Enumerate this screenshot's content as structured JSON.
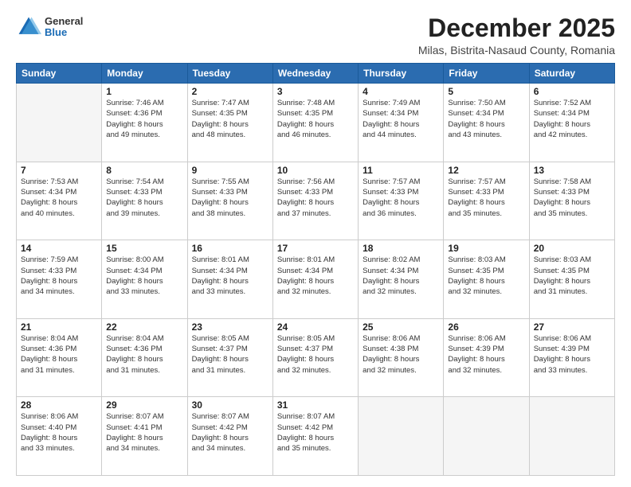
{
  "logo": {
    "general": "General",
    "blue": "Blue"
  },
  "title": "December 2025",
  "location": "Milas, Bistrita-Nasaud County, Romania",
  "days_header": [
    "Sunday",
    "Monday",
    "Tuesday",
    "Wednesday",
    "Thursday",
    "Friday",
    "Saturday"
  ],
  "weeks": [
    [
      {
        "day": "",
        "info": ""
      },
      {
        "day": "1",
        "info": "Sunrise: 7:46 AM\nSunset: 4:36 PM\nDaylight: 8 hours\nand 49 minutes."
      },
      {
        "day": "2",
        "info": "Sunrise: 7:47 AM\nSunset: 4:35 PM\nDaylight: 8 hours\nand 48 minutes."
      },
      {
        "day": "3",
        "info": "Sunrise: 7:48 AM\nSunset: 4:35 PM\nDaylight: 8 hours\nand 46 minutes."
      },
      {
        "day": "4",
        "info": "Sunrise: 7:49 AM\nSunset: 4:34 PM\nDaylight: 8 hours\nand 44 minutes."
      },
      {
        "day": "5",
        "info": "Sunrise: 7:50 AM\nSunset: 4:34 PM\nDaylight: 8 hours\nand 43 minutes."
      },
      {
        "day": "6",
        "info": "Sunrise: 7:52 AM\nSunset: 4:34 PM\nDaylight: 8 hours\nand 42 minutes."
      }
    ],
    [
      {
        "day": "7",
        "info": "Sunrise: 7:53 AM\nSunset: 4:34 PM\nDaylight: 8 hours\nand 40 minutes."
      },
      {
        "day": "8",
        "info": "Sunrise: 7:54 AM\nSunset: 4:33 PM\nDaylight: 8 hours\nand 39 minutes."
      },
      {
        "day": "9",
        "info": "Sunrise: 7:55 AM\nSunset: 4:33 PM\nDaylight: 8 hours\nand 38 minutes."
      },
      {
        "day": "10",
        "info": "Sunrise: 7:56 AM\nSunset: 4:33 PM\nDaylight: 8 hours\nand 37 minutes."
      },
      {
        "day": "11",
        "info": "Sunrise: 7:57 AM\nSunset: 4:33 PM\nDaylight: 8 hours\nand 36 minutes."
      },
      {
        "day": "12",
        "info": "Sunrise: 7:57 AM\nSunset: 4:33 PM\nDaylight: 8 hours\nand 35 minutes."
      },
      {
        "day": "13",
        "info": "Sunrise: 7:58 AM\nSunset: 4:33 PM\nDaylight: 8 hours\nand 35 minutes."
      }
    ],
    [
      {
        "day": "14",
        "info": "Sunrise: 7:59 AM\nSunset: 4:33 PM\nDaylight: 8 hours\nand 34 minutes."
      },
      {
        "day": "15",
        "info": "Sunrise: 8:00 AM\nSunset: 4:34 PM\nDaylight: 8 hours\nand 33 minutes."
      },
      {
        "day": "16",
        "info": "Sunrise: 8:01 AM\nSunset: 4:34 PM\nDaylight: 8 hours\nand 33 minutes."
      },
      {
        "day": "17",
        "info": "Sunrise: 8:01 AM\nSunset: 4:34 PM\nDaylight: 8 hours\nand 32 minutes."
      },
      {
        "day": "18",
        "info": "Sunrise: 8:02 AM\nSunset: 4:34 PM\nDaylight: 8 hours\nand 32 minutes."
      },
      {
        "day": "19",
        "info": "Sunrise: 8:03 AM\nSunset: 4:35 PM\nDaylight: 8 hours\nand 32 minutes."
      },
      {
        "day": "20",
        "info": "Sunrise: 8:03 AM\nSunset: 4:35 PM\nDaylight: 8 hours\nand 31 minutes."
      }
    ],
    [
      {
        "day": "21",
        "info": "Sunrise: 8:04 AM\nSunset: 4:36 PM\nDaylight: 8 hours\nand 31 minutes."
      },
      {
        "day": "22",
        "info": "Sunrise: 8:04 AM\nSunset: 4:36 PM\nDaylight: 8 hours\nand 31 minutes."
      },
      {
        "day": "23",
        "info": "Sunrise: 8:05 AM\nSunset: 4:37 PM\nDaylight: 8 hours\nand 31 minutes."
      },
      {
        "day": "24",
        "info": "Sunrise: 8:05 AM\nSunset: 4:37 PM\nDaylight: 8 hours\nand 32 minutes."
      },
      {
        "day": "25",
        "info": "Sunrise: 8:06 AM\nSunset: 4:38 PM\nDaylight: 8 hours\nand 32 minutes."
      },
      {
        "day": "26",
        "info": "Sunrise: 8:06 AM\nSunset: 4:39 PM\nDaylight: 8 hours\nand 32 minutes."
      },
      {
        "day": "27",
        "info": "Sunrise: 8:06 AM\nSunset: 4:39 PM\nDaylight: 8 hours\nand 33 minutes."
      }
    ],
    [
      {
        "day": "28",
        "info": "Sunrise: 8:06 AM\nSunset: 4:40 PM\nDaylight: 8 hours\nand 33 minutes."
      },
      {
        "day": "29",
        "info": "Sunrise: 8:07 AM\nSunset: 4:41 PM\nDaylight: 8 hours\nand 34 minutes."
      },
      {
        "day": "30",
        "info": "Sunrise: 8:07 AM\nSunset: 4:42 PM\nDaylight: 8 hours\nand 34 minutes."
      },
      {
        "day": "31",
        "info": "Sunrise: 8:07 AM\nSunset: 4:42 PM\nDaylight: 8 hours\nand 35 minutes."
      },
      {
        "day": "",
        "info": ""
      },
      {
        "day": "",
        "info": ""
      },
      {
        "day": "",
        "info": ""
      }
    ]
  ]
}
